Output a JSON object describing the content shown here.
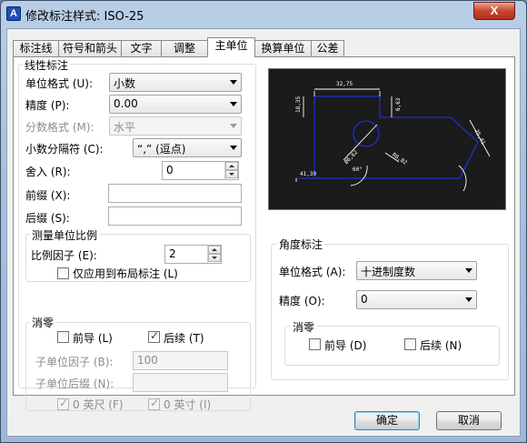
{
  "window": {
    "title": "修改标注样式: ISO-25",
    "close_label": "X"
  },
  "tabs": [
    "标注线",
    "符号和箭头",
    "文字",
    "调整",
    "主单位",
    "换算单位",
    "公差"
  ],
  "linear": {
    "group_title": "线性标注",
    "unit_format_label": "单位格式 (U):",
    "unit_format_value": "小数",
    "precision_label": "精度 (P):",
    "precision_value": "0.00",
    "fraction_format_label": "分数格式 (M):",
    "fraction_format_value": "水平",
    "decimal_sep_label": "小数分隔符 (C):",
    "decimal_sep_value": "“,” (逗点)",
    "round_label": "舍入 (R):",
    "round_value": "0",
    "prefix_label": "前缀 (X):",
    "prefix_value": "",
    "suffix_label": "后缀 (S):",
    "suffix_value": ""
  },
  "scale": {
    "group_title": "测量单位比例",
    "factor_label": "比例因子 (E):",
    "factor_value": "2",
    "layout_only_label": "仅应用到布局标注 (L)"
  },
  "zero_linear": {
    "group_title": "消零",
    "leading_label": "前导 (L)",
    "trailing_label": "后续 (T)",
    "sub_factor_label": "子单位因子 (B):",
    "sub_factor_value": "100",
    "sub_suffix_label": "子单位后缀 (N):",
    "sub_suffix_value": "",
    "feet_label": "0 英尺 (F)",
    "inches_label": "0 英寸 (I)"
  },
  "angular": {
    "group_title": "角度标注",
    "unit_format_label": "单位格式 (A):",
    "unit_format_value": "十进制度数",
    "precision_label": "精度 (O):",
    "precision_value": "0"
  },
  "zero_angular": {
    "group_title": "消零",
    "leading_label": "前导 (D)",
    "trailing_label": "后续 (N)"
  },
  "preview": {
    "dim_top": "32,75",
    "dim_left": "18,35",
    "dim_right": "25,41",
    "dim_small": "6,63",
    "dim_diag1": "Ø6,62",
    "dim_diag2": "R8,82",
    "dim_bottom": "41,39",
    "dim_arc": "60°"
  },
  "buttons": {
    "ok": "确定",
    "cancel": "取消"
  },
  "colors": {
    "preview_bg": "#1b1b1b",
    "preview_lines": "#1d2fd0",
    "preview_dims": "#ffffff"
  }
}
